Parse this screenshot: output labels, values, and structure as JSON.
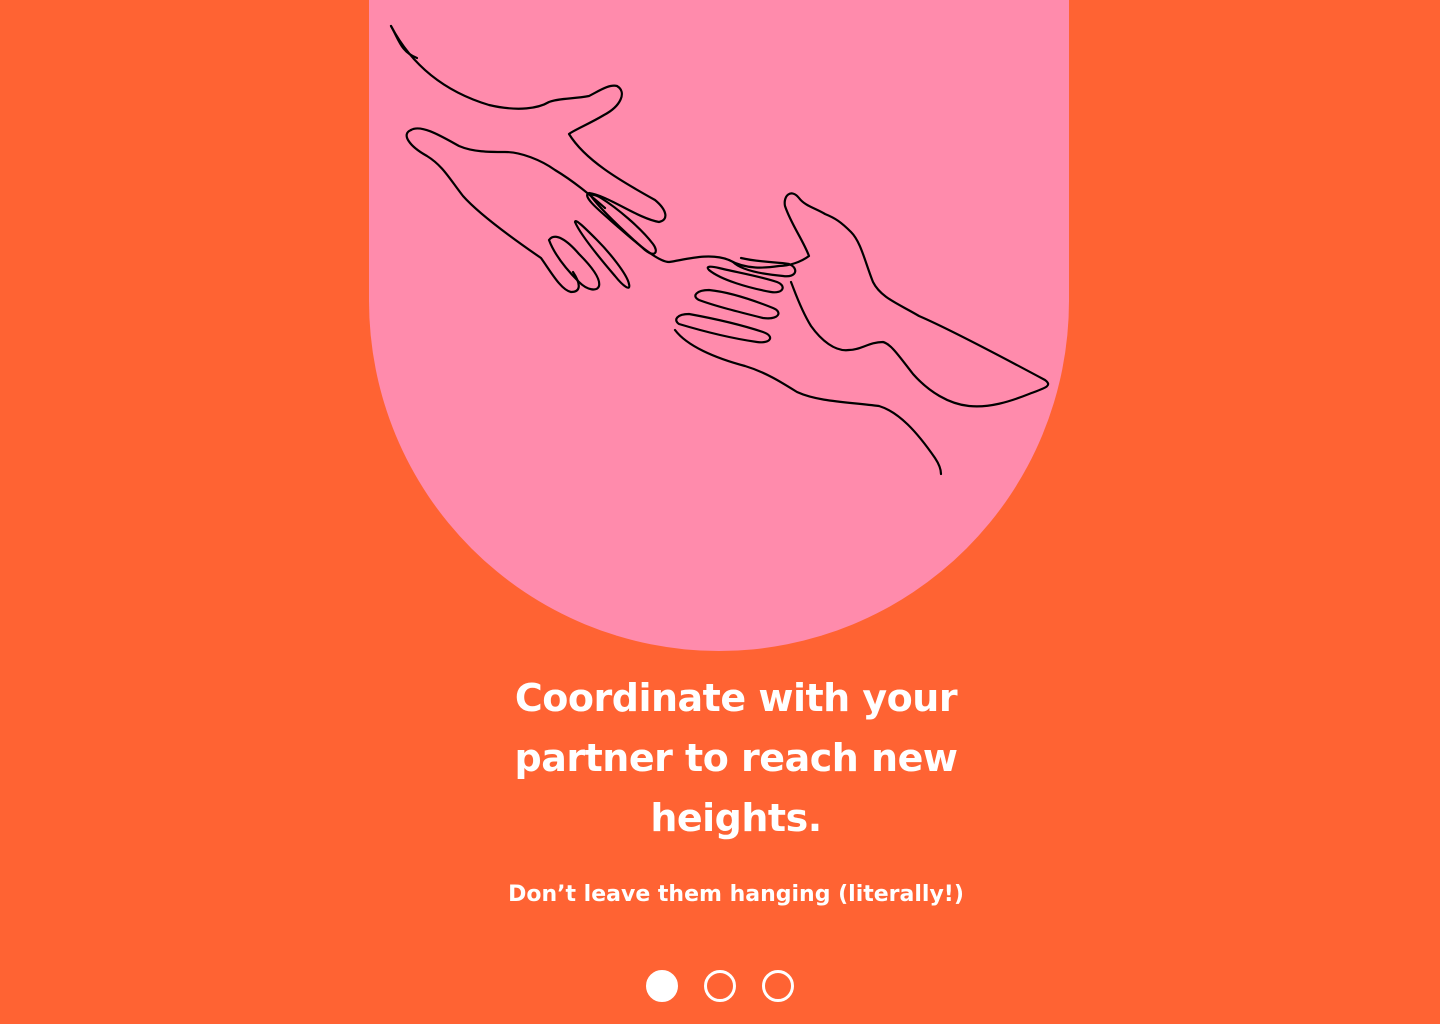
{
  "colors": {
    "background": "#FF6333",
    "arch": "#FF8BAC",
    "text": "#FFFFFF",
    "illustration_stroke": "#000000"
  },
  "illustration": {
    "icon": "reaching-hands-line-art-icon"
  },
  "onboarding": {
    "headline": "Coordinate with your partner to reach new heights.",
    "subheadline": "Don’t leave them hanging (literally!)"
  },
  "pagination": {
    "total_pages": 3,
    "current_page": 1
  }
}
